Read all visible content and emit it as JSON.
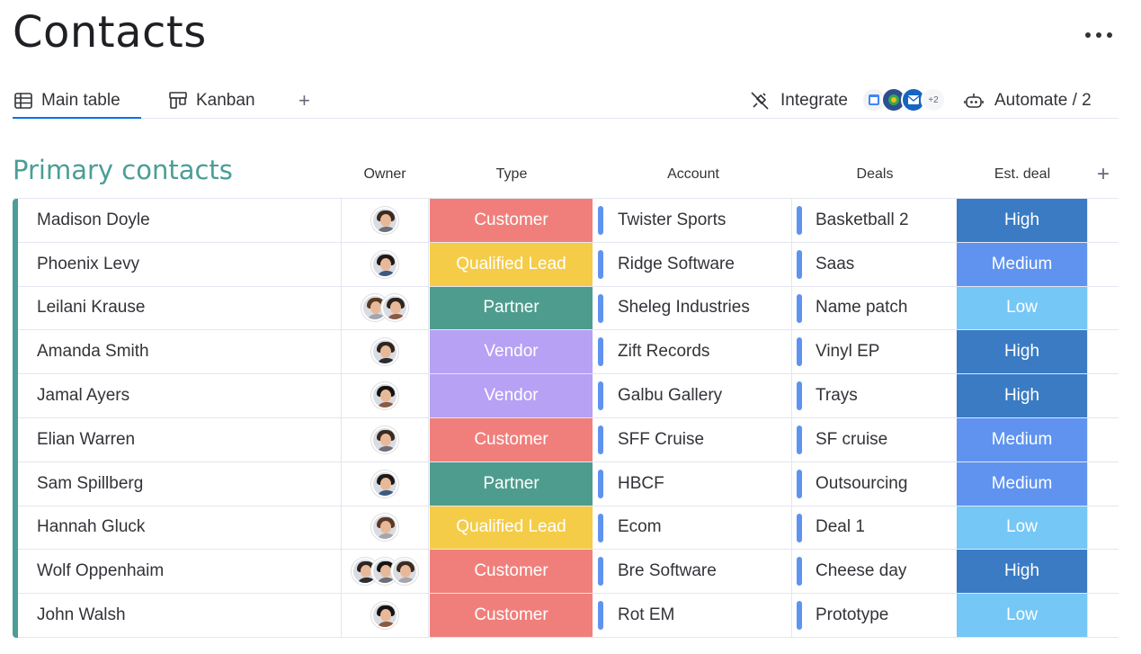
{
  "page": {
    "title": "Contacts"
  },
  "tabs": {
    "main": "Main table",
    "kanban": "Kanban",
    "add": "+",
    "integrate": "Integrate",
    "integrate_more": "+2",
    "automate": "Automate / 2"
  },
  "group": {
    "title": "Primary contacts",
    "color": "#4a9e97",
    "columns": {
      "owner": "Owner",
      "type": "Type",
      "account": "Account",
      "deals": "Deals",
      "est_deal": "Est. deal",
      "add": "+"
    }
  },
  "colors": {
    "Customer": "#f07f7b",
    "Qualified Lead": "#f5cc48",
    "Partner": "#4e9c8e",
    "Vendor": "#b6a1f4",
    "High": "#3a7bc4",
    "Medium": "#5f93ef",
    "Low": "#75c7f5",
    "link_bar": "#5f93ef"
  },
  "rows": [
    {
      "name": "Madison Doyle",
      "owners": 1,
      "type": "Customer",
      "account": "Twister Sports",
      "deal": "Basketball 2",
      "est": "High"
    },
    {
      "name": "Phoenix Levy",
      "owners": 1,
      "type": "Qualified Lead",
      "account": "Ridge Software",
      "deal": "Saas",
      "est": "Medium"
    },
    {
      "name": "Leilani Krause",
      "owners": 2,
      "type": "Partner",
      "account": "Sheleg Industries",
      "deal": "Name patch",
      "est": "Low"
    },
    {
      "name": "Amanda Smith",
      "owners": 1,
      "type": "Vendor",
      "account": "Zift Records",
      "deal": "Vinyl EP",
      "est": "High"
    },
    {
      "name": "Jamal Ayers",
      "owners": 1,
      "type": "Vendor",
      "account": "Galbu Gallery",
      "deal": "Trays",
      "est": "High"
    },
    {
      "name": "Elian Warren",
      "owners": 1,
      "type": "Customer",
      "account": "SFF Cruise",
      "deal": "SF cruise",
      "est": "Medium"
    },
    {
      "name": "Sam Spillberg",
      "owners": 1,
      "type": "Partner",
      "account": "HBCF",
      "deal": "Outsourcing",
      "est": "Medium"
    },
    {
      "name": "Hannah Gluck",
      "owners": 1,
      "type": "Qualified Lead",
      "account": "Ecom",
      "deal": "Deal 1",
      "est": "Low"
    },
    {
      "name": "Wolf Oppenhaim",
      "owners": 3,
      "type": "Customer",
      "account": "Bre Software",
      "deal": "Cheese day",
      "est": "High"
    },
    {
      "name": "John Walsh",
      "owners": 1,
      "type": "Customer",
      "account": "Rot EM",
      "deal": "Prototype",
      "est": "Low"
    }
  ]
}
